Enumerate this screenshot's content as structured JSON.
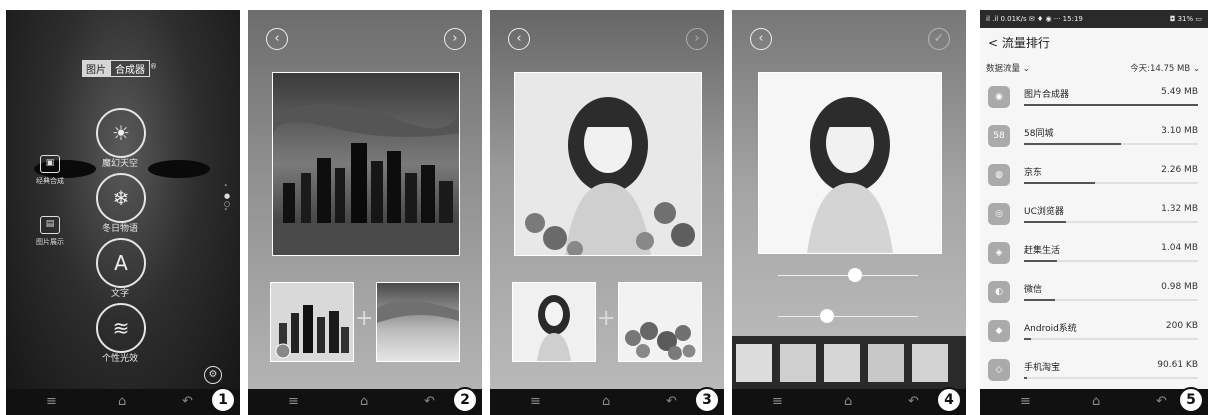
{
  "panel1": {
    "title_seg1": "图片",
    "title_seg2": "合成器",
    "title_sup": "®",
    "modes": [
      "魔幻天空",
      "冬日物语",
      "文字",
      "个性光效"
    ],
    "side_items": [
      "经典合成",
      "图片展示"
    ],
    "badge": "1"
  },
  "panel2": {
    "badge": "2"
  },
  "panel3": {
    "badge": "3"
  },
  "panel4": {
    "badge": "4",
    "slider1_level": 0.55,
    "slider2_level": 0.35
  },
  "panel5": {
    "status_left": "il .il 0.01K/s ✉ ♦ ◉ ··· 15:19",
    "status_right": "◘ 31% ▭",
    "header": "< 流量排行",
    "data_label": "数据流量",
    "today_total": "今天:14.75 MB",
    "apps": [
      {
        "name": "图片合成器",
        "size": "5.49 MB",
        "level": 1.0
      },
      {
        "name": "58同城",
        "size": "3.10 MB",
        "level": 0.56
      },
      {
        "name": "京东",
        "size": "2.26 MB",
        "level": 0.41
      },
      {
        "name": "UC浏览器",
        "size": "1.32 MB",
        "level": 0.24
      },
      {
        "name": "赶集生活",
        "size": "1.04 MB",
        "level": 0.19
      },
      {
        "name": "微信",
        "size": "0.98 MB",
        "level": 0.18
      },
      {
        "name": "Android系统",
        "size": "200 KB",
        "level": 0.04
      },
      {
        "name": "手机淘宝",
        "size": "90.61 KB",
        "level": 0.02
      }
    ],
    "badge": "5"
  },
  "nav_icons": [
    "menu-icon",
    "home-icon",
    "back-icon"
  ]
}
